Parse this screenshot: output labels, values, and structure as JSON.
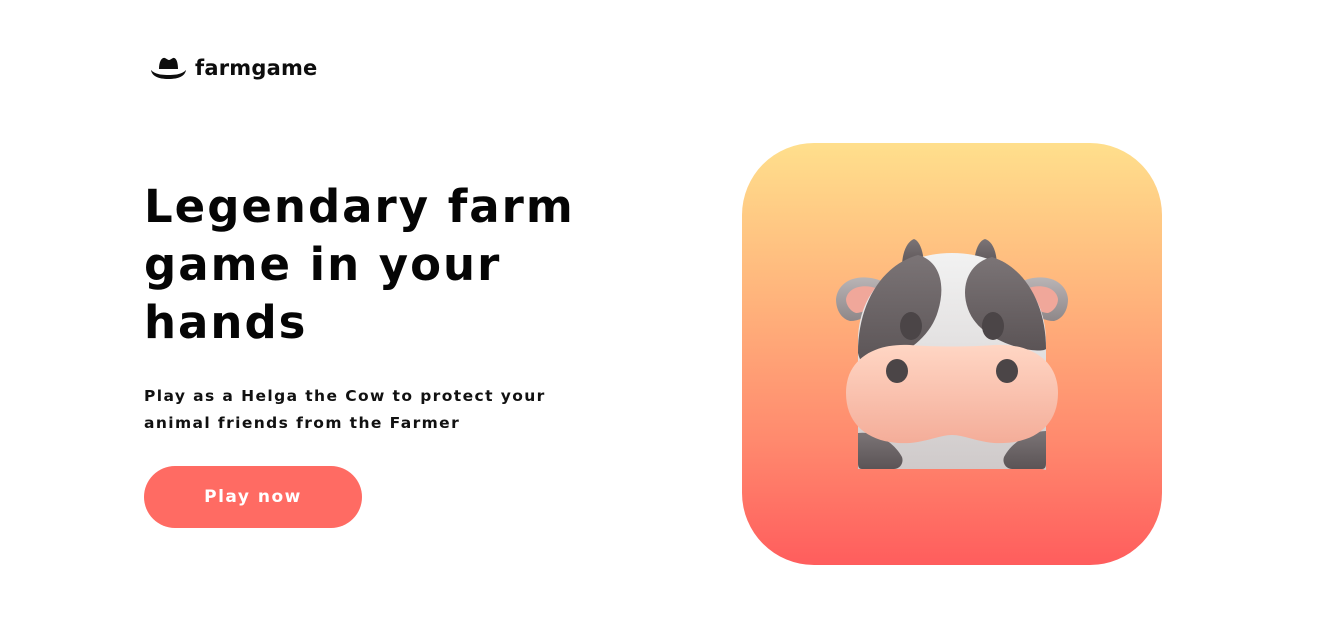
{
  "brand": {
    "name": "farmgame",
    "icon": "cowboy-hat-icon"
  },
  "hero": {
    "title": "Legendary farm game in your hands",
    "subtitle": "Play as a Helga the Cow to protect your animal friends from the Farmer",
    "cta_label": "Play now"
  },
  "app_tile": {
    "illustration": "cow-face-icon"
  },
  "colors": {
    "accent": "#ff6b63",
    "tile_gradient_top": "#ffdf8c",
    "tile_gradient_bottom": "#ff5d5d",
    "text": "#0d0d0d"
  }
}
